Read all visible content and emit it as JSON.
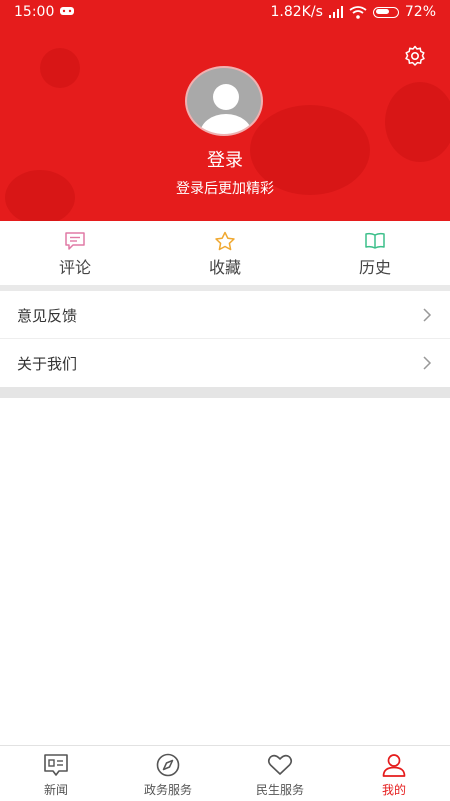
{
  "status_bar": {
    "time": "15:00",
    "network_speed": "1.82K/s",
    "battery": "72%"
  },
  "header": {
    "login_title": "登录",
    "login_subtitle": "登录后更加精彩",
    "background_color": "#e51c1c"
  },
  "quick_actions": [
    {
      "label": "评论",
      "icon": "comment-icon",
      "color": "#e07aa5"
    },
    {
      "label": "收藏",
      "icon": "star-icon",
      "color": "#f0a830"
    },
    {
      "label": "历史",
      "icon": "book-icon",
      "color": "#3cbf8a"
    }
  ],
  "menu": [
    {
      "label": "意见反馈"
    },
    {
      "label": "关于我们"
    }
  ],
  "tabbar": {
    "active_color": "#e51c1c",
    "items": [
      {
        "label": "新闻",
        "icon": "news-icon",
        "active": false
      },
      {
        "label": "政务服务",
        "icon": "compass-icon",
        "active": false
      },
      {
        "label": "民生服务",
        "icon": "heart-icon",
        "active": false
      },
      {
        "label": "我的",
        "icon": "user-icon",
        "active": true
      }
    ]
  }
}
